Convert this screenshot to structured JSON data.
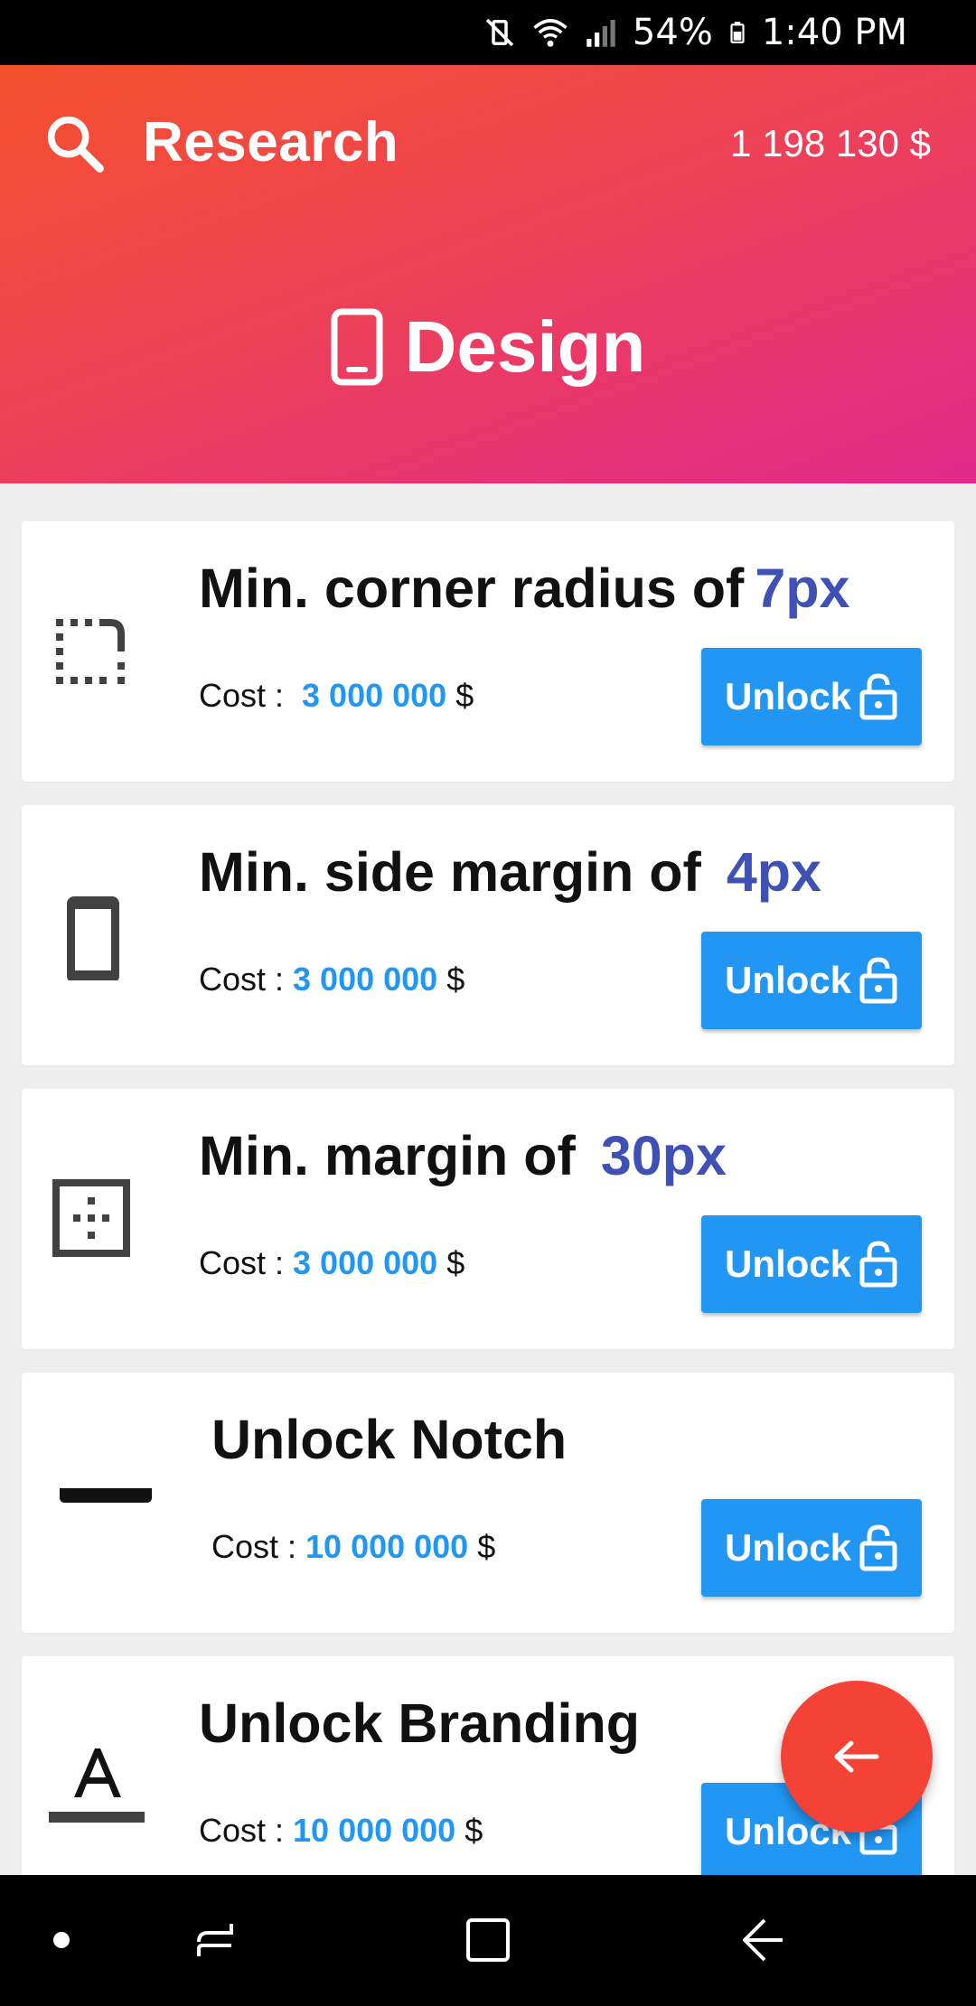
{
  "status_bar": {
    "battery": "54%",
    "time": "1:40 PM"
  },
  "header": {
    "title": "Research",
    "balance": "1 198 130  $",
    "section": "Design"
  },
  "cards": [
    {
      "title": "Min. corner radius of",
      "value": "7px",
      "cost_label": "Cost :",
      "cost": "3 000 000",
      "currency": "$",
      "button": "Unlock",
      "icon": "corner-radius-icon"
    },
    {
      "title": "Min. side margin of",
      "value": "4px",
      "cost_label": "Cost :",
      "cost": "3 000 000",
      "currency": "$",
      "button": "Unlock",
      "icon": "phone-icon"
    },
    {
      "title": "Min. margin of",
      "value": "30px",
      "cost_label": "Cost :",
      "cost": "3 000 000",
      "currency": "$",
      "button": "Unlock",
      "icon": "margin-grid-icon"
    },
    {
      "title": "Unlock Notch",
      "value": "",
      "cost_label": "Cost :",
      "cost": "10 000 000",
      "currency": "$",
      "button": "Unlock",
      "icon": "notch-icon"
    },
    {
      "title": "Unlock Branding",
      "value": "",
      "cost_label": "Cost :",
      "cost": "10 000 000",
      "currency": "$",
      "button": "Unlock",
      "icon": "branding-icon"
    }
  ],
  "fab": {
    "icon": "back-arrow-icon"
  },
  "nav_bar": {
    "icons": [
      "nav-dot-icon",
      "recent-apps-icon",
      "home-icon",
      "back-icon"
    ]
  },
  "colors": {
    "accent": "#2196f3",
    "value": "#3f51b5",
    "fab": "#f44336",
    "header_start": "#f5502c",
    "header_end": "#e2288a"
  }
}
